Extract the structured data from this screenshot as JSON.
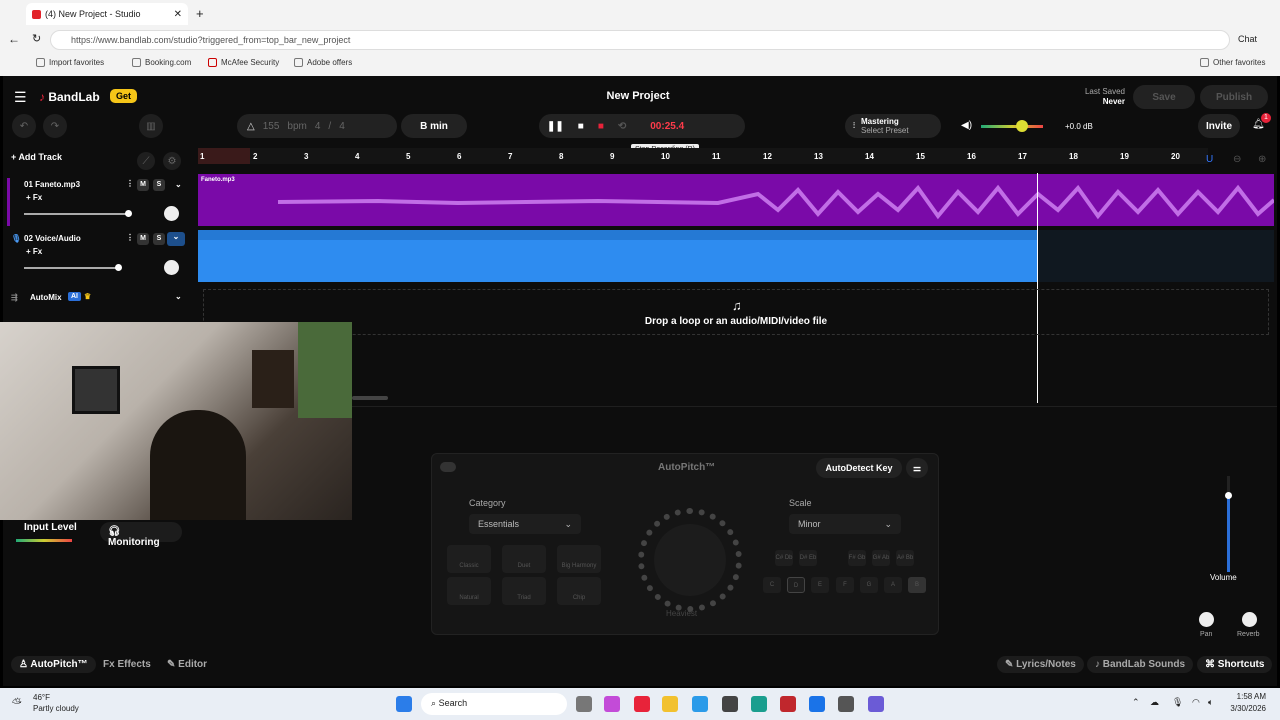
{
  "browser": {
    "tab_title": "(4) New Project - Studio",
    "url": "https://www.bandlab.com/studio?triggered_from=top_bar_new_project",
    "chat_label": "Chat",
    "bookmarks": [
      "Import favorites",
      "Booking.com",
      "McAfee Security",
      "Adobe offers"
    ],
    "other_favorites": "Other favorites"
  },
  "app": {
    "brand": "BandLab",
    "get_label": "Get",
    "project_title": "New Project",
    "last_saved_label": "Last Saved",
    "last_saved_value": "Never",
    "save_label": "Save",
    "publish_label": "Publish",
    "bpm_value": "155",
    "bpm_unit": "bpm",
    "time_sig_num": "4",
    "time_sig_den": "4",
    "key": "B min",
    "timer": "00:25.4",
    "tooltip": "Stop Recording (R)",
    "mastering_label": "Mastering",
    "mastering_preset": "Select Preset",
    "volume_db": "+0.0 dB",
    "invite_label": "Invite",
    "notif_count": "1",
    "add_track": "Add Track",
    "ruler_marks": [
      "1",
      "2",
      "3",
      "4",
      "5",
      "6",
      "7",
      "8",
      "9",
      "10",
      "11",
      "12",
      "13",
      "14",
      "15",
      "16",
      "17",
      "18",
      "19",
      "20"
    ],
    "tracks": [
      {
        "name": "01  Faneto.mp3",
        "fx": "+ Fx",
        "m": "M",
        "s": "S",
        "clip": "Faneto.mp3"
      },
      {
        "name": "02  Voice/Audio",
        "fx": "+ Fx",
        "m": "M",
        "s": "S"
      }
    ],
    "automix": "AutoMix",
    "automix_badge": "AI",
    "drop_text": "Drop a loop or an audio/MIDI/video file",
    "input_level": "Input Level",
    "monitoring": "Monitoring",
    "autopitch": {
      "title": "AutoPitch™",
      "autodetect": "AutoDetect Key",
      "category_label": "Category",
      "category_value": "Essentials",
      "scale_label": "Scale",
      "scale_value": "Minor",
      "presets": [
        "Classic",
        "Duet",
        "Big Harmony",
        "Natural",
        "Triad",
        "Chip"
      ],
      "dial_label": "Heaviest",
      "sharp_keys": [
        "C#\nDb",
        "D#\nEb",
        "F#\nGb",
        "G#\nAb",
        "A#\nBb"
      ],
      "keys": [
        "C",
        "D",
        "E",
        "F",
        "G",
        "A",
        "B"
      ]
    },
    "volume_label": "Volume",
    "pan_label": "Pan",
    "reverb_label": "Reverb",
    "bottom_tabs": [
      "AutoPitch™",
      "Effects",
      "Editor"
    ],
    "lyrics": "Lyrics/Notes",
    "sounds": "BandLab Sounds",
    "shortcuts": "Shortcuts"
  },
  "taskbar": {
    "temp": "46°F",
    "weather": "Partly cloudy",
    "search": "Search",
    "time": "1:58 AM",
    "date": "3/30/2026"
  },
  "colors": {
    "purple_clip": "#7a0aa8",
    "blue_clip": "#2e8cf0",
    "record_red": "#e8233a",
    "timer_red": "#ff3b4a",
    "get_yellow": "#f5c518"
  }
}
